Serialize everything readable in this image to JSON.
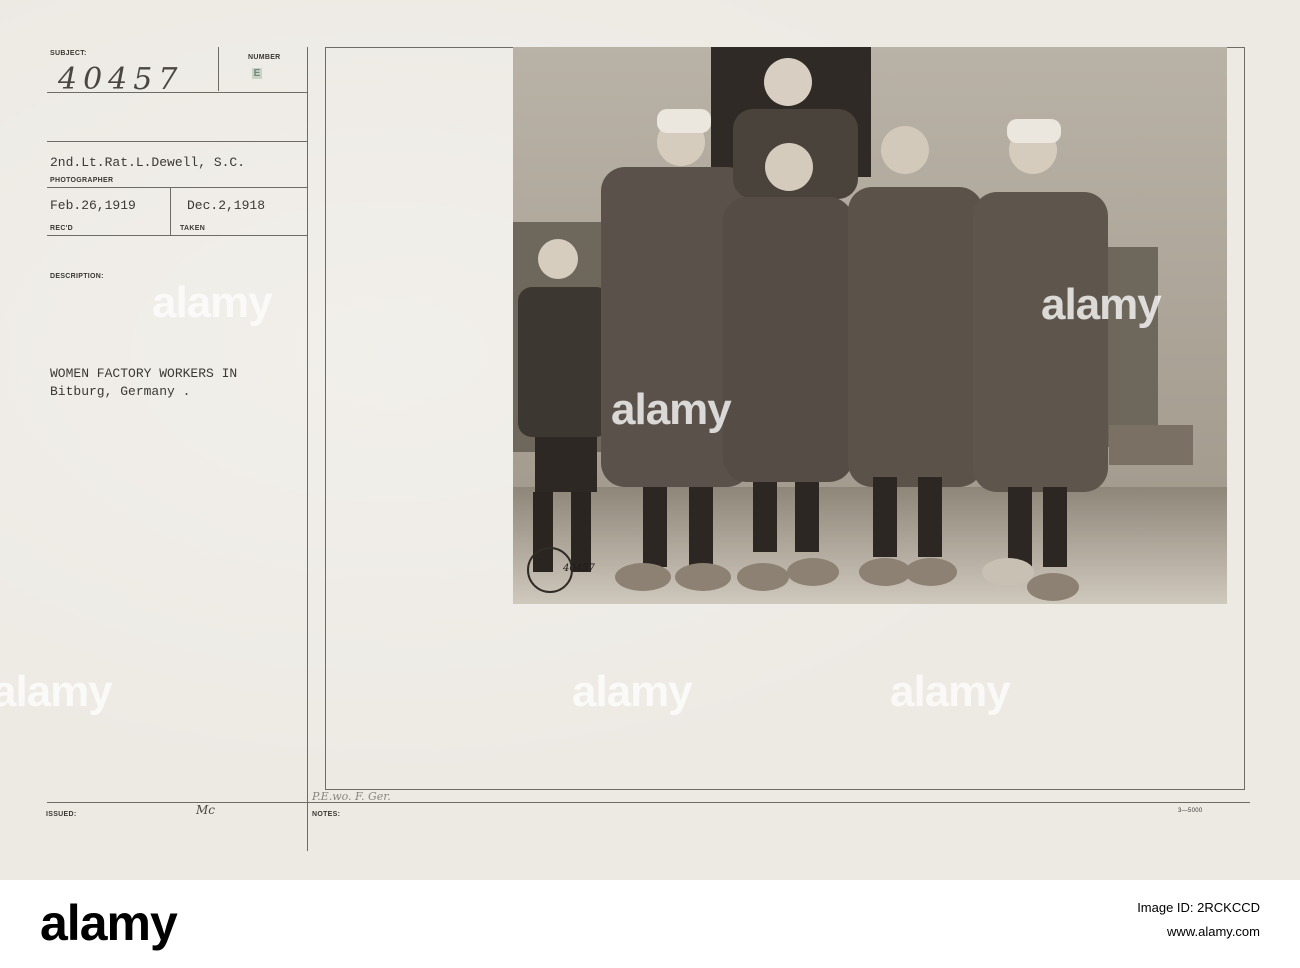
{
  "card": {
    "subject_label": "SUBJECT:",
    "number_label": "NUMBER",
    "subject_value": "40457",
    "number_value": "E",
    "photographer_value": "2nd.Lt.Rat.L.Dewell, S.C.",
    "photographer_label": "PHOTOGRAPHER",
    "recd_value": "Feb.26,1919",
    "recd_label": "REC'D",
    "taken_value": "Dec.2,1918",
    "taken_label": "TAKEN",
    "description_label": "DESCRIPTION:",
    "description_line1": "WOMEN FACTORY WORKERS IN",
    "description_line2": "Bitburg, Germany .",
    "issued_label": "ISSUED:",
    "issued_value": "Mc",
    "notes_label": "NOTES:",
    "notes_value": "P.E.wo. F. Ger.",
    "form_number": "3—5000"
  },
  "photo": {
    "stamp_text": "SIGNAL CORPS U.S.A.",
    "stamp_number": "40457"
  },
  "watermarks": {
    "text": "alamy"
  },
  "footer": {
    "brand": "alamy",
    "image_id_line": "Image ID: 2RCKCCD",
    "url": "www.alamy.com"
  }
}
